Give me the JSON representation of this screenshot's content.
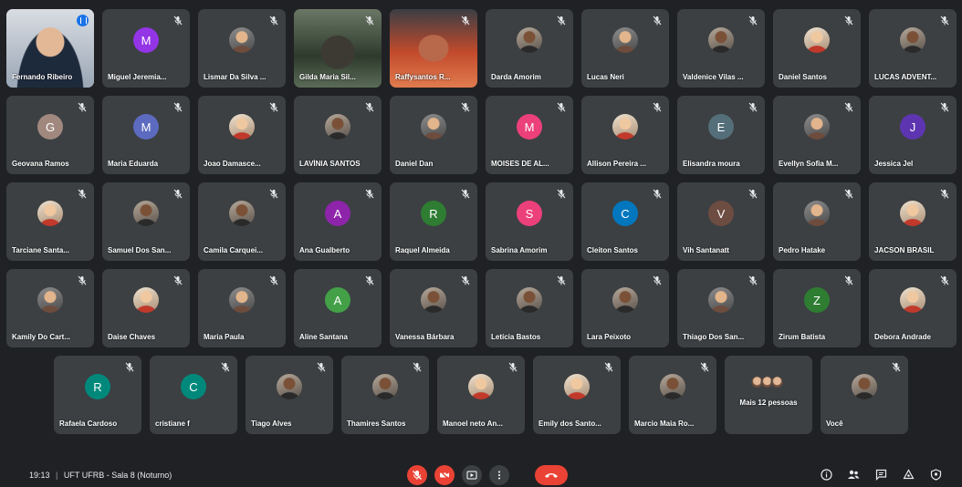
{
  "participants": [
    {
      "name": "Fernando Ribeiro",
      "kind": "video",
      "variant": "cam-a",
      "speaking": true,
      "pinned": true
    },
    {
      "name": "Miguel Jeremia...",
      "kind": "initial",
      "initial": "M",
      "color": "#9334e6"
    },
    {
      "name": "Lismar Da Silva ...",
      "kind": "photo",
      "variant": ""
    },
    {
      "name": "Gilda Maria Sil...",
      "kind": "video",
      "variant": "cam-b"
    },
    {
      "name": "Raffysantos R...",
      "kind": "video",
      "variant": "cam-c"
    },
    {
      "name": "Darda Amorim",
      "kind": "photo",
      "variant": "dark"
    },
    {
      "name": "Lucas Neri",
      "kind": "photo",
      "variant": ""
    },
    {
      "name": "Valdenice Vilas ...",
      "kind": "photo",
      "variant": "dark"
    },
    {
      "name": "Daniel Santos",
      "kind": "photo",
      "variant": "warm"
    },
    {
      "name": "LUCAS ADVENT...",
      "kind": "photo",
      "variant": "dark"
    },
    {
      "name": "Geovana Ramos",
      "kind": "initial",
      "initial": "G",
      "color": "#a1887f"
    },
    {
      "name": "Maria Eduarda",
      "kind": "initial",
      "initial": "M",
      "color": "#5c6bc0"
    },
    {
      "name": "Joao Damasce...",
      "kind": "photo",
      "variant": "warm"
    },
    {
      "name": "LAVÍNIA SANTOS",
      "kind": "photo",
      "variant": "dark"
    },
    {
      "name": "Daniel Dan",
      "kind": "photo",
      "variant": ""
    },
    {
      "name": "MOISES DE AL...",
      "kind": "initial",
      "initial": "M",
      "color": "#ec407a"
    },
    {
      "name": "Allison Pereira ...",
      "kind": "photo",
      "variant": "warm"
    },
    {
      "name": "Elisandra moura",
      "kind": "initial",
      "initial": "E",
      "color": "#546e7a"
    },
    {
      "name": "Evellyn Sofia M...",
      "kind": "photo",
      "variant": ""
    },
    {
      "name": "Jessica Jel",
      "kind": "initial",
      "initial": "J",
      "color": "#5e35b1"
    },
    {
      "name": "Tarciane Santa...",
      "kind": "photo",
      "variant": "warm"
    },
    {
      "name": "Samuel Dos San...",
      "kind": "photo",
      "variant": "dark"
    },
    {
      "name": "Camila Carquei...",
      "kind": "photo",
      "variant": "dark"
    },
    {
      "name": "Ana Gualberto",
      "kind": "initial",
      "initial": "A",
      "color": "#8e24aa"
    },
    {
      "name": "Raquel Almeida",
      "kind": "initial",
      "initial": "R",
      "color": "#2e7d32"
    },
    {
      "name": "Sabrina Amorim",
      "kind": "initial",
      "initial": "S",
      "color": "#ec407a"
    },
    {
      "name": "Cleiton Santos",
      "kind": "initial",
      "initial": "C",
      "color": "#0277bd"
    },
    {
      "name": "Vih Santanatt",
      "kind": "initial",
      "initial": "V",
      "color": "#6d4c41"
    },
    {
      "name": "Pedro Hatake",
      "kind": "photo",
      "variant": ""
    },
    {
      "name": "JACSON BRASIL",
      "kind": "photo",
      "variant": "warm"
    },
    {
      "name": "Kamily Do Cart...",
      "kind": "photo",
      "variant": ""
    },
    {
      "name": "Daise Chaves",
      "kind": "photo",
      "variant": "warm"
    },
    {
      "name": "Maria Paula",
      "kind": "photo",
      "variant": ""
    },
    {
      "name": "Aline Santana",
      "kind": "initial",
      "initial": "A",
      "color": "#43a047"
    },
    {
      "name": "Vanessa Bárbara",
      "kind": "photo",
      "variant": "dark"
    },
    {
      "name": "Letícia Bastos",
      "kind": "photo",
      "variant": "dark"
    },
    {
      "name": "Lara Peixoto",
      "kind": "photo",
      "variant": "dark"
    },
    {
      "name": "Thiago Dos San...",
      "kind": "photo",
      "variant": ""
    },
    {
      "name": "Zirum Batista",
      "kind": "initial",
      "initial": "Z",
      "color": "#2e7d32"
    },
    {
      "name": "Debora Andrade",
      "kind": "photo",
      "variant": "warm"
    },
    {
      "name": "Rafaela Cardoso",
      "kind": "initial",
      "initial": "R",
      "color": "#00897b"
    },
    {
      "name": "cristiane f",
      "kind": "initial",
      "initial": "C",
      "color": "#00897b"
    },
    {
      "name": "Tiago Alves",
      "kind": "photo",
      "variant": "dark"
    },
    {
      "name": "Thamires Santos",
      "kind": "photo",
      "variant": "dark"
    },
    {
      "name": "Manoel neto An...",
      "kind": "photo",
      "variant": "warm"
    },
    {
      "name": "Emily dos Santo...",
      "kind": "photo",
      "variant": "warm"
    },
    {
      "name": "Marcio Maia Ro...",
      "kind": "photo",
      "variant": "dark"
    },
    {
      "name": "Mais 12 pessoas",
      "kind": "more"
    },
    {
      "name": "Você",
      "kind": "photo",
      "variant": "dark"
    }
  ],
  "bottom_bar": {
    "time": "19:13",
    "separator": "|",
    "meeting_name": "UFT UFRB - Sala 8 (Noturno)"
  },
  "colors": {
    "background": "#202124",
    "tile": "#3c4043",
    "danger": "#ea4335",
    "accent": "#8ab4f8"
  },
  "icons": {
    "mic_off": "mic-off-icon",
    "camera_off": "camera-off-icon",
    "present": "present-screen-icon",
    "more": "more-options-icon",
    "hangup": "hang-up-icon",
    "info": "info-icon",
    "people": "people-icon",
    "chat": "chat-icon",
    "activities": "activities-icon",
    "host": "host-controls-icon"
  }
}
